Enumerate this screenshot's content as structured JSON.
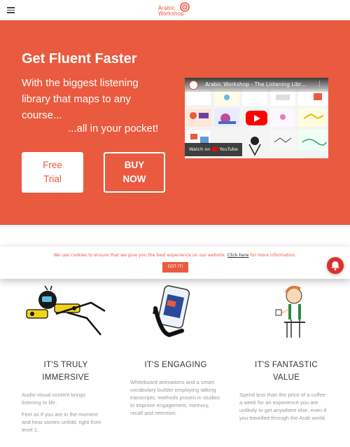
{
  "header": {
    "menu_icon": "hamburger-menu-icon",
    "logo": {
      "line1": "Arabic",
      "line2": "Workshop",
      "icon": "arabic-workshop-swirl-icon"
    }
  },
  "hero": {
    "title": "Get Fluent Faster",
    "subtitle": "With the biggest listening library that maps to any course...",
    "pocket": "...all in your pocket!",
    "free_trial_line1": "Free",
    "free_trial_line2": "Trial",
    "buy_now_line1": "BUY",
    "buy_now_line2": "NOW",
    "background_color": "#ea5a3f"
  },
  "video": {
    "title": "Arabic Workshop - The Listening Libr...",
    "more_icon": "more-vertical-icon",
    "watch_on": "Watch on",
    "youtube": "YouTube"
  },
  "cookie": {
    "text_before": "We use cookies to ensure that we give you the best experience on our website.",
    "link": "Click here",
    "text_after": "for more information.",
    "button": "GOT IT!"
  },
  "notification": {
    "icon": "bell-icon"
  },
  "features": [
    {
      "title_line1": "IT'S TRULY",
      "title_line2": "IMMERSIVE",
      "paragraphs": [
        "Audio-visual content brings listening to life.",
        "Feel as if you are in the moment and hear stories unfold, right from level 1."
      ]
    },
    {
      "title_line1": "IT'S ENGAGING",
      "title_line2": "",
      "paragraphs": [
        "Whiteboard animations and a smart vocabulary builder employing talking transcripts; methods proven in studies to improve engagement, memory, recall and retention."
      ]
    },
    {
      "title_line1": "IT'S FANTASTIC",
      "title_line2": "VALUE",
      "paragraphs": [
        "Spend less than the price of a coffee a week for an experience you are unlikely to get anywhere else, even if you travelled through the Arab world."
      ]
    }
  ]
}
